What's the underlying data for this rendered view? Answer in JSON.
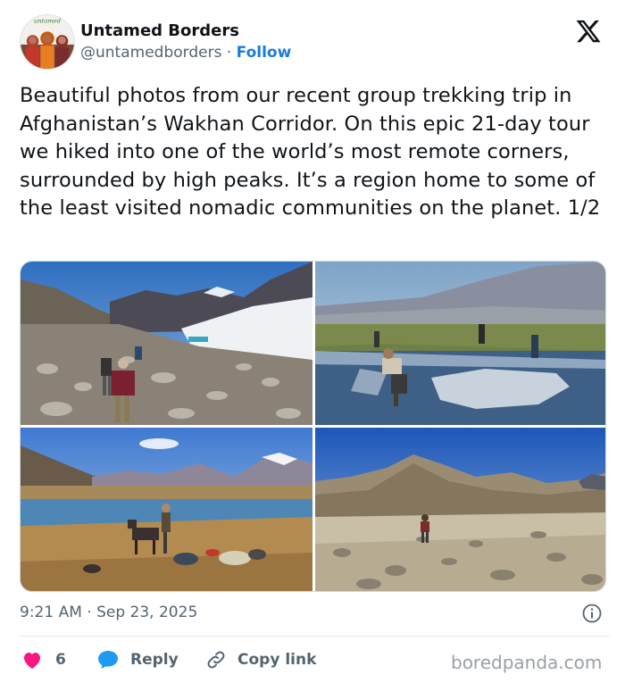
{
  "author": {
    "name": "Untamed Borders",
    "handle": "@untamedborders",
    "separator": "·",
    "follow_label": "Follow",
    "avatar_icon": "group-photo-avatar"
  },
  "platform_icon": "x-logo-icon",
  "tweet": {
    "text": "Beautiful photos from our recent group trekking trip in Afghanistan’s Wakhan Corridor. On this epic 21-day tour we hiked into one of the world’s most remote corners, surrounded by high peaks. It’s a region home to some of the least visited nomadic communities on the planet. 1/2"
  },
  "media": [
    {
      "icon": "photo-trekkers-rocky-slope"
    },
    {
      "icon": "photo-fishing-net-river"
    },
    {
      "icon": "photo-donkey-lake-camp"
    },
    {
      "icon": "photo-hiker-rocky-valley"
    }
  ],
  "meta": {
    "time": "9:21 AM",
    "separator": "·",
    "date": "Sep 23, 2025"
  },
  "actions": {
    "like_count": "6",
    "reply_label": "Reply",
    "copy_label": "Copy link"
  },
  "colors": {
    "like": "#f91880",
    "reply": "#1d9bf0",
    "follow": "#1d7bd8",
    "muted": "#536471"
  },
  "watermark": "boredpanda.com"
}
